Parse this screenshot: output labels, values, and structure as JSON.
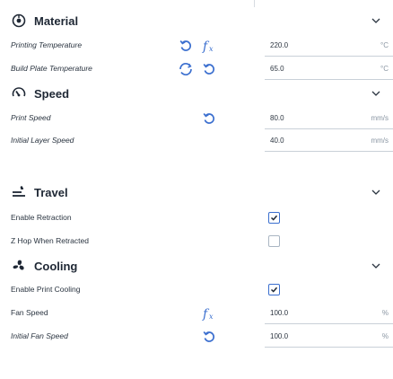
{
  "sections": {
    "material": {
      "title": "Material",
      "icon": "material-icon"
    },
    "speed": {
      "title": "Speed",
      "icon": "speedometer-icon"
    },
    "travel": {
      "title": "Travel",
      "icon": "travel-icon"
    },
    "cooling": {
      "title": "Cooling",
      "icon": "fan-icon"
    }
  },
  "settings": {
    "printing_temperature": {
      "label": "Printing Temperature",
      "value": "220.0",
      "unit": "°C"
    },
    "build_plate_temperature": {
      "label": "Build Plate Temperature",
      "value": "65.0",
      "unit": "°C"
    },
    "print_speed": {
      "label": "Print Speed",
      "value": "80.0",
      "unit": "mm/s"
    },
    "initial_layer_speed": {
      "label": "Initial Layer Speed",
      "value": "40.0",
      "unit": "mm/s"
    },
    "enable_retraction": {
      "label": "Enable Retraction",
      "checked": true
    },
    "z_hop_when_retracted": {
      "label": "Z Hop When Retracted",
      "checked": false
    },
    "enable_print_cooling": {
      "label": "Enable Print Cooling",
      "checked": true
    },
    "fan_speed": {
      "label": "Fan Speed",
      "value": "100.0",
      "unit": "%"
    },
    "initial_fan_speed": {
      "label": "Initial Fan Speed",
      "value": "100.0",
      "unit": "%"
    }
  },
  "icons": {
    "reset": "reset-icon",
    "function": "function-icon",
    "linked": "linked-settings-icon",
    "chevron": "chevron-down-icon"
  },
  "colors": {
    "accent": "#3b6fcf",
    "text": "#1f2a36",
    "muted": "#8a96a3",
    "divider": "#c9d0d8"
  }
}
